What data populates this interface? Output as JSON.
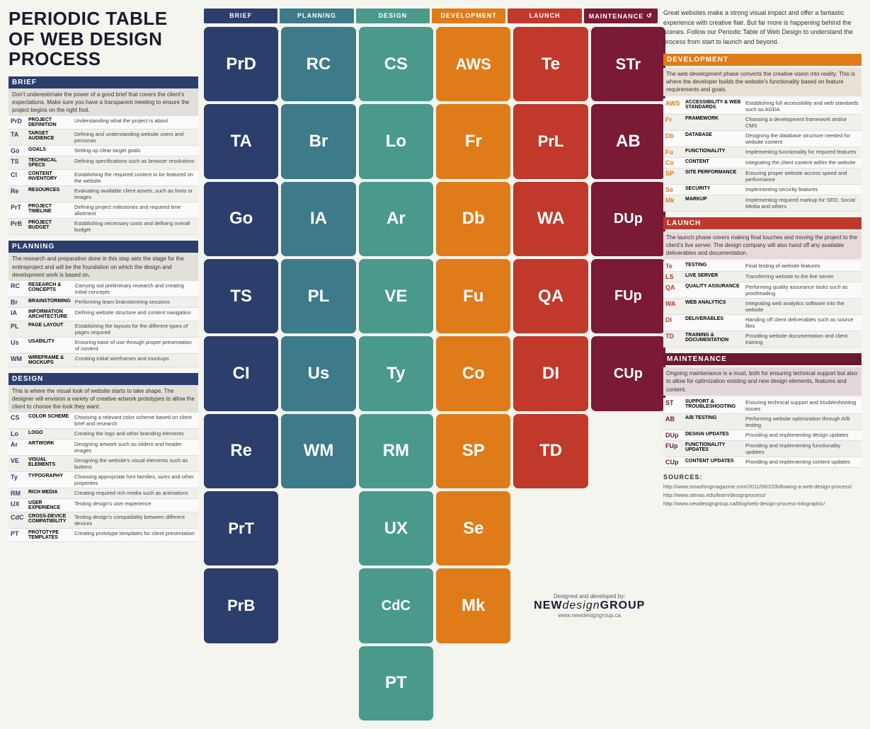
{
  "title": "PERIODIC TABLE OF WEB DESIGN PROCESS",
  "right_intro": "Great websites make a strong visual impact and offer a fantastic experience with creative flair. But far more is happening behind the scenes. Follow our Periodic Table of Web Design to understand the process from start to launch and beyond.",
  "phases": [
    "BRIEF",
    "PLANNING",
    "DESIGN",
    "DEVELOPMENT",
    "LAUNCH",
    "MAINTENANCE"
  ],
  "sections": {
    "brief": {
      "title": "BRIEF",
      "desc": "Don't underestimate the power of a good brief that covers the client's expectations. Make sure you have a transparent meeting to ensure the project begins on the right foot.",
      "items": [
        {
          "code": "PrD",
          "name": "PROJECT DEFINITION",
          "desc": "Understanding what the project is about"
        },
        {
          "code": "TA",
          "name": "TARGET AUDIENCE",
          "desc": "Defining and understanding website users and personas"
        },
        {
          "code": "Go",
          "name": "GOALS",
          "desc": "Setting up clear target goals"
        },
        {
          "code": "TS",
          "name": "TECHNICAL SPECS",
          "desc": "Defining specifications such as browser resolutions"
        },
        {
          "code": "CI",
          "name": "CONTENT INVENTORY",
          "desc": "Establishing the required content to be featured on the website"
        },
        {
          "code": "Re",
          "name": "RESOURCES",
          "desc": "Evaluating available client assets, such as fonts or images"
        },
        {
          "code": "PrT",
          "name": "PROJECT TIMELINE",
          "desc": "Defining project milestones and required time allotment"
        },
        {
          "code": "PrB",
          "name": "PROJECT BUDGET",
          "desc": "Establishing necessary costs and defining overall budget"
        }
      ]
    },
    "planning": {
      "title": "PLANNING",
      "desc": "The research and preparation done in this step sets the stage for the entireproject and will be the foundation on which the design and development work is based on.",
      "items": [
        {
          "code": "RC",
          "name": "RESEARCH & CONCEPTS",
          "desc": "Carrying out preliminary research and creating initial concepts"
        },
        {
          "code": "Br",
          "name": "BRAINSTORMING",
          "desc": "Performing team brainstorming sessions"
        },
        {
          "code": "IA",
          "name": "INFORMATION ARCHITECTURE",
          "desc": "Defining website structure and content navigation"
        },
        {
          "code": "PL",
          "name": "PAGE LAYOUT",
          "desc": "Establishing the layouts for the different types of pages required"
        },
        {
          "code": "Us",
          "name": "USABILITY",
          "desc": "Ensuring ease of use through proper presentation of content"
        },
        {
          "code": "WM",
          "name": "WIREFRAME & MOCKUPS",
          "desc": "Creating initial wireframes and mockups"
        }
      ]
    },
    "design": {
      "title": "DESIGN",
      "desc": "This is where the visual look of website starts to take shape. The designer will envision a variety of creative artwork prototypes to allow the client to choose the look they want.",
      "items": [
        {
          "code": "CS",
          "name": "COLOR SCHEME",
          "desc": "Choosing a relevant color scheme based on client brief and research"
        },
        {
          "code": "Lo",
          "name": "LOGO",
          "desc": "Creating the logo and other branding elements"
        },
        {
          "code": "Ar",
          "name": "ARTWORK",
          "desc": "Designing artwork such as sliders and header images"
        },
        {
          "code": "VE",
          "name": "VISUAL ELEMENTS",
          "desc": "Designing the website's visual elements such as buttons"
        },
        {
          "code": "Ty",
          "name": "TYPOGRAPHY",
          "desc": "Choosing appropriate font families, sizes and other properties"
        },
        {
          "code": "RM",
          "name": "RICH MEDIA",
          "desc": "Creating required rich media such as animations"
        },
        {
          "code": "UX",
          "name": "USER EXPERIENCE",
          "desc": "Testing design's user experience"
        },
        {
          "code": "CdC",
          "name": "CROSS-DEVICE COMPATIBILITY",
          "desc": "Testing design's compatibility between different devices"
        },
        {
          "code": "PT",
          "name": "PROTOTYPE TEMPLATES",
          "desc": "Creating prototype templates for client presentation"
        }
      ]
    }
  },
  "grid": [
    [
      "PrD",
      "RC",
      "CS",
      "AWS",
      "Te",
      "STr"
    ],
    [
      "TA",
      "Br",
      "Lo",
      "Fr",
      "PrL",
      "AB"
    ],
    [
      "Go",
      "IA",
      "Ar",
      "Db",
      "WA",
      "DUp"
    ],
    [
      "TS",
      "PL",
      "VE",
      "Fu",
      "QA",
      "FUp"
    ],
    [
      "CI",
      "Us",
      "Ty",
      "Co",
      "DI",
      "CUp"
    ],
    [
      "Re",
      "WM",
      "RM",
      "SP",
      "TD",
      ""
    ],
    [
      "PrT",
      "",
      "UX",
      "Se",
      "",
      ""
    ],
    [
      "PrB",
      "",
      "CdC",
      "Mk",
      "",
      ""
    ],
    [
      "",
      "",
      "PT",
      "",
      "",
      ""
    ]
  ],
  "grid_classes": [
    [
      "brief-col",
      "planning-col",
      "design-col",
      "development-col",
      "launch-col",
      "maintenance-col"
    ],
    [
      "brief-col",
      "planning-col",
      "design-col",
      "development-col",
      "launch-col",
      "maintenance-col"
    ],
    [
      "brief-col",
      "planning-col",
      "design-col",
      "development-col",
      "launch-col",
      "maintenance-col"
    ],
    [
      "brief-col",
      "planning-col",
      "design-col",
      "development-col",
      "launch-col",
      "maintenance-col"
    ],
    [
      "brief-col",
      "planning-col",
      "design-col",
      "development-col",
      "launch-col",
      "maintenance-col"
    ],
    [
      "brief-col",
      "planning-col",
      "design-col",
      "development-col",
      "launch-col",
      "empty"
    ],
    [
      "brief-col",
      "empty",
      "design-col",
      "development-col",
      "empty",
      "empty"
    ],
    [
      "brief-col",
      "empty",
      "design-col",
      "development-col",
      "empty",
      "empty"
    ],
    [
      "empty",
      "empty",
      "design-col",
      "empty",
      "empty",
      "empty"
    ]
  ],
  "right_development": {
    "title": "DEVELOPMENT",
    "desc": "The web development phase converts the creative vision into reality. This is where the developer builds the website's functionality based on feature requirements and goals.",
    "items": [
      {
        "code": "AWS",
        "name": "ACCESSIBILITY & WEB STANDARDS",
        "desc": "Establishing full accessibility and web standards such as AODA"
      },
      {
        "code": "Fr",
        "name": "FRAMEWORK",
        "desc": "Choosing a development framework and/or CMS"
      },
      {
        "code": "Db",
        "name": "DATABASE",
        "desc": "Designing the database structure needed for website content"
      },
      {
        "code": "Fu",
        "name": "FUNCTIONALITY",
        "desc": "Implementing functionality for required features"
      },
      {
        "code": "Co",
        "name": "CONTENT",
        "desc": "Integrating the client content within the website"
      },
      {
        "code": "SP",
        "name": "SITE PERFORMANCE",
        "desc": "Ensuring proper website access speed and performance"
      },
      {
        "code": "Se",
        "name": "SECURITY",
        "desc": "Implementing security features"
      },
      {
        "code": "Mk",
        "name": "MARKUP",
        "desc": "Implementing required markup for SEO, Social Media and others"
      }
    ]
  },
  "right_launch": {
    "title": "LAUNCH",
    "desc": "The launch phase covers making final touches and moving the project to the client's live server. The design company will also hand off any available deliverables and documentation.",
    "items": [
      {
        "code": "Te",
        "name": "TESTING",
        "desc": "Final testing of website features"
      },
      {
        "code": "LS",
        "name": "LIVE SERVER",
        "desc": "Transferring website to the live server"
      },
      {
        "code": "QA",
        "name": "QUALITY ASSURANCE",
        "desc": "Performing quality assurance tasks such as proofreading"
      },
      {
        "code": "WA",
        "name": "WEB ANALYTICS",
        "desc": "Integrating web analytics software into the website"
      },
      {
        "code": "DI",
        "name": "DELIVERABLES",
        "desc": "Handing off client deliverables such as source files"
      },
      {
        "code": "TD",
        "name": "TRAINING & DOCUMENTATION",
        "desc": "Providing website documentation and client training"
      }
    ]
  },
  "right_maintenance": {
    "title": "MAINTENANCE",
    "desc": "Ongoing maintenance is a must, both for ensuring technical support but also to allow for optimization existing and new design elements, features and content.",
    "items": [
      {
        "code": "ST",
        "name": "SUPPORT & TROUBLESHOOTING",
        "desc": "Ensuring technical support and troubleshooting issues"
      },
      {
        "code": "AB",
        "name": "A/B TESTING",
        "desc": "Performing website optimization through A/B testing"
      },
      {
        "code": "DUp",
        "name": "DESIGN UPDATES",
        "desc": "Providing and implementing design updates"
      },
      {
        "code": "FUp",
        "name": "FUNCTIONALITY UPDATES",
        "desc": "Providing and implementing functionality updates"
      },
      {
        "code": "CUp",
        "name": "CONTENT UPDATES",
        "desc": "Providing and implementing content updates"
      }
    ]
  },
  "sources": {
    "title": "SOURCES:",
    "items": [
      "http://www.smashingmagazine.com/2011/06/22/following-a-web-design-process/",
      "http://www.utexas.edu/learn/designprocess/",
      "http://www.newdesigngroup.ca/blog/web-design-process-infographic/"
    ]
  },
  "logo": {
    "designed_by": "Designed and developed by:",
    "brand": "NEW",
    "brand_italic": "design",
    "brand_end": "GROUP",
    "website": "www.newdesigngroup.ca"
  }
}
